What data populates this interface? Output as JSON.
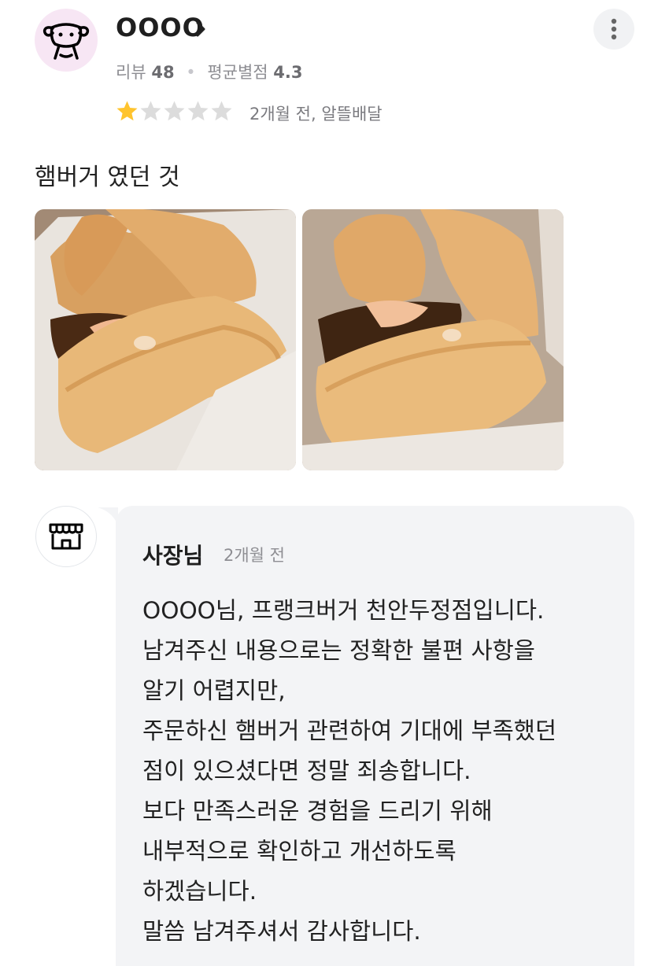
{
  "review": {
    "user": {
      "name": "OOOO",
      "avatar_icon": "cow-avatar-icon",
      "review_count_label": "리뷰",
      "review_count": "48",
      "avg_rating_label": "평균별점",
      "avg_rating": "4.3"
    },
    "rating": 1,
    "rating_max": 5,
    "time_and_type": "2개월 전, 알뜰배달",
    "text": "햄버거 였던 것",
    "photos": [
      "hamburger-photo-1",
      "hamburger-photo-2"
    ]
  },
  "reply": {
    "owner_icon": "store-icon",
    "name": "사장님",
    "time": "2개월 전",
    "lines": [
      "OOOO님, 프랭크버거 천안두정점입니다.",
      "남겨주신 내용으로는 정확한 불편 사항을",
      "알기 어렵지만,",
      "주문하신 햄버거 관련하여 기대에 부족했던",
      "점이 있으셨다면 정말 죄송합니다.",
      "보다 만족스러운 경험을 드리기 위해",
      "내부적으로 확인하고 개선하도록",
      "하겠습니다.",
      "말씀 남겨주셔서 감사합니다."
    ]
  },
  "colors": {
    "star_filled": "#FFC42E",
    "star_empty": "#DCDCDC",
    "avatar_bg": "#F7E6F4",
    "reply_bg": "#F3F4F6"
  }
}
